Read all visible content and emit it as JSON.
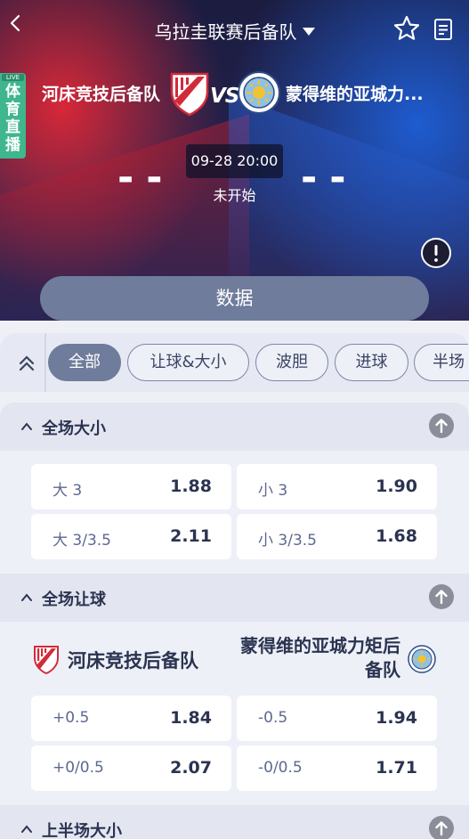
{
  "header": {
    "league_title": "乌拉圭联赛后备队",
    "live_badge_mini": "LIVE",
    "live_badge_text": "体育直播"
  },
  "match": {
    "home_team": "河床竞技后备队",
    "away_team_short": "蒙得维的亚城力...",
    "vs": "VS",
    "home_score": "--",
    "away_score": "--",
    "time": "09-28 20:00",
    "status": "未开始"
  },
  "data_tab_label": "数据",
  "filter_chips": [
    "全部",
    "让球&大小",
    "波胆",
    "进球",
    "半场"
  ],
  "sections": {
    "total": {
      "title": "全场大小",
      "rows": [
        [
          {
            "label": "大 3",
            "odds": "1.88"
          },
          {
            "label": "小 3",
            "odds": "1.90"
          }
        ],
        [
          {
            "label": "大 3/3.5",
            "odds": "2.11"
          },
          {
            "label": "小 3/3.5",
            "odds": "1.68"
          }
        ]
      ]
    },
    "handicap": {
      "title": "全场让球",
      "home_team": "河床竞技后备队",
      "away_team": "蒙得维的亚城力矩后备队",
      "rows": [
        [
          {
            "label": "+0.5",
            "odds": "1.84"
          },
          {
            "label": "-0.5",
            "odds": "1.94"
          }
        ],
        [
          {
            "label": "+0/0.5",
            "odds": "2.07"
          },
          {
            "label": "-0/0.5",
            "odds": "1.71"
          }
        ]
      ]
    },
    "half_total": {
      "title": "上半场大小"
    }
  },
  "colors": {
    "accent": "#6f7c9b",
    "home_red": "#e0263a",
    "away_blue": "#1e5fd7",
    "live_green": "#3fb68d"
  },
  "icons": [
    "back-arrow-icon",
    "star-icon",
    "list-icon",
    "info-icon",
    "double-chevron-up-icon",
    "chevron-up-icon",
    "arrow-up-circle-icon"
  ]
}
